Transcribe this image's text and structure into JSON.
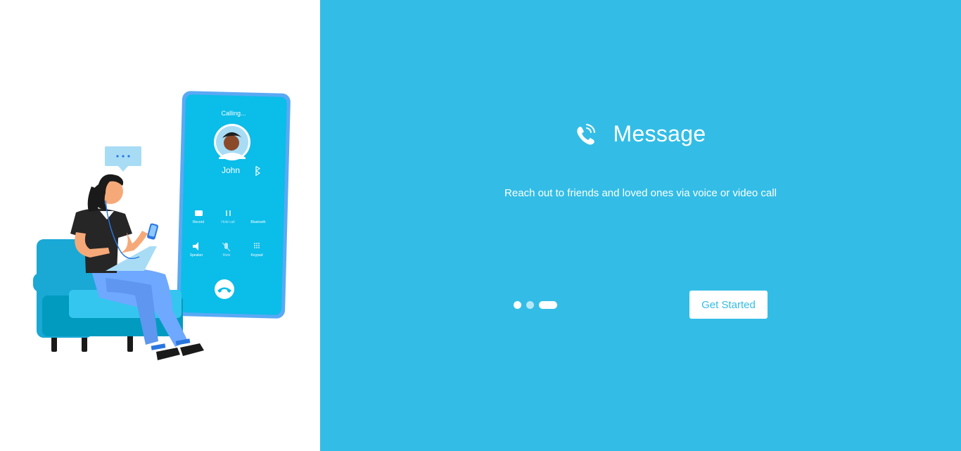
{
  "illustration": {
    "phone_status": "Calling...",
    "caller_name": "John",
    "phone_buttons": [
      {
        "label": "Record",
        "icon": "record-icon"
      },
      {
        "label": "Hold call",
        "icon": "pause-icon"
      },
      {
        "label": "Bluetooth",
        "icon": "bluetooth-icon"
      },
      {
        "label": "Speaker",
        "icon": "speaker-icon"
      },
      {
        "label": "Mute",
        "icon": "mic-off-icon"
      },
      {
        "label": "Keypad",
        "icon": "keypad-icon"
      }
    ],
    "chat_bubble": "...",
    "end_call_icon": "hang-up-icon"
  },
  "onboarding": {
    "icon": "phone-call-icon",
    "title": "Message",
    "subtitle": "Reach out to friends and loved ones via voice or video call",
    "pagination": {
      "total": 3,
      "active_index": 2
    },
    "cta_label": "Get Started"
  },
  "colors": {
    "accent": "#33bde6",
    "phone_screen": "#0bbde9",
    "phone_frame": "#5aa9f5",
    "sofa": "#1aa8d4",
    "pants": "#6fa8ff"
  }
}
